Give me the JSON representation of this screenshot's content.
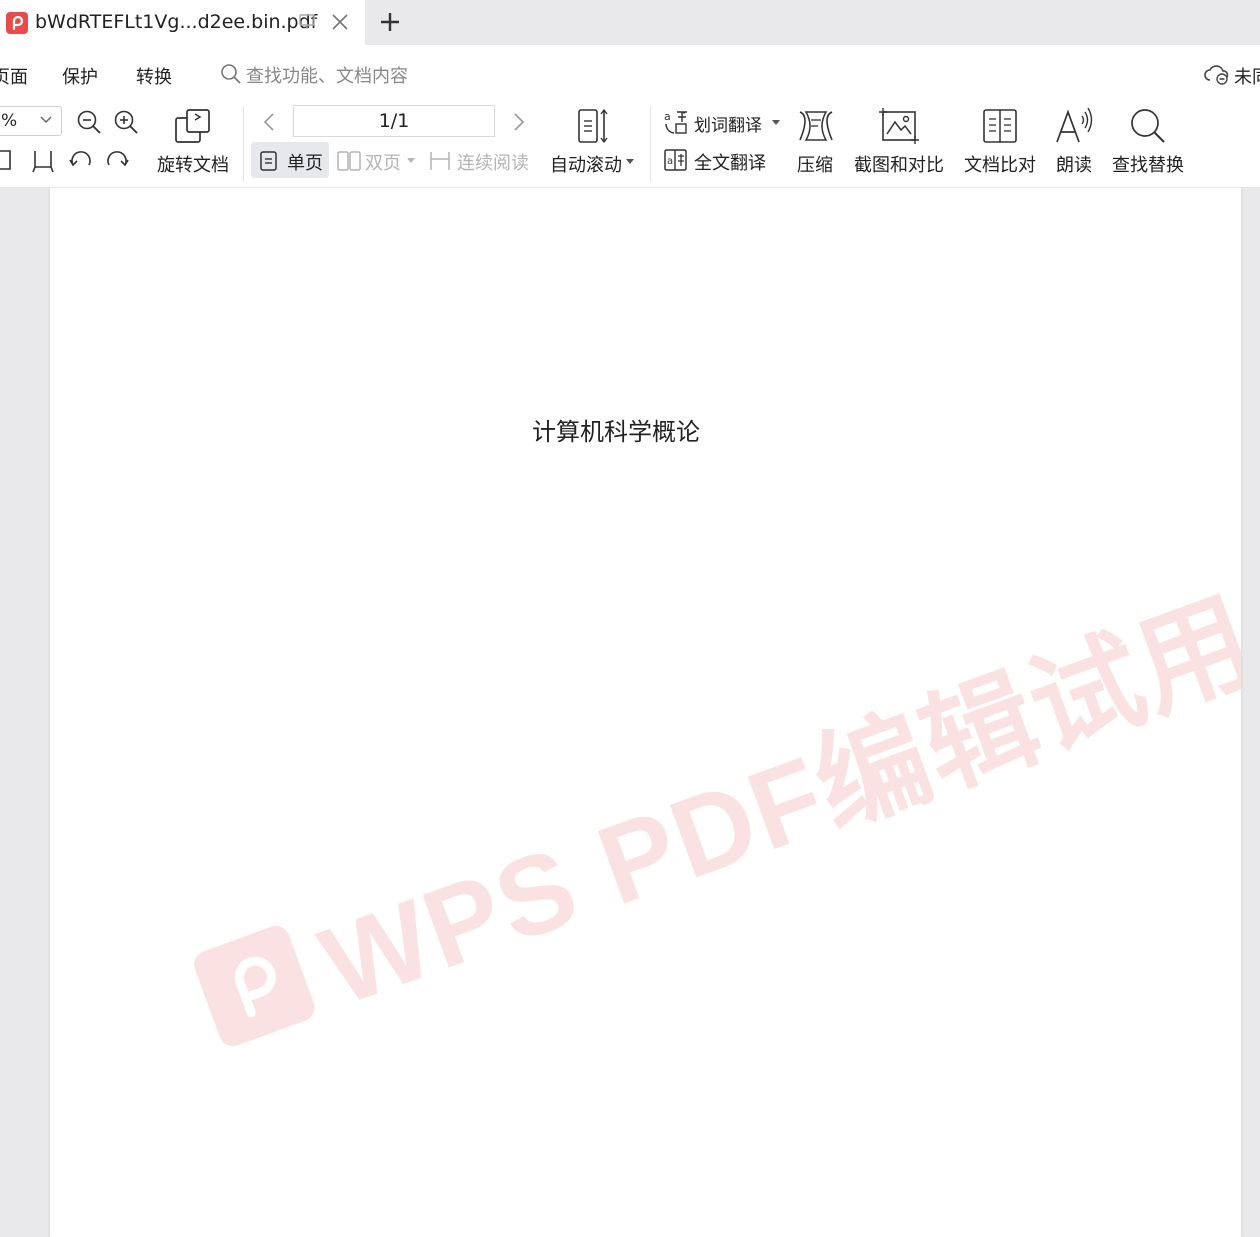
{
  "tab": {
    "title": "bWdRTEFLt1Vg...d2ee.bin.pdf",
    "new_tab": "+"
  },
  "menu": {
    "items": [
      "页面",
      "保护",
      "转换"
    ],
    "search_placeholder": "查找功能、文档内容",
    "cloud_status": "未同"
  },
  "toolbar": {
    "zoom_value": "%",
    "rotate_doc": "旋转文档",
    "page_indicator": "1/1",
    "single_page": "单页",
    "double_page": "双页",
    "continuous": "连续阅读",
    "auto_scroll": "自动滚动",
    "word_translate": "划词翻译",
    "full_translate": "全文翻译",
    "compress": "压缩",
    "screenshot_compare": "截图和对比",
    "doc_compare": "文档比对",
    "read_aloud": "朗读",
    "find_replace": "查找替换"
  },
  "document": {
    "title": "计算机科学概论",
    "watermark": "WPS PDF编辑试用"
  },
  "colors": {
    "accent_red": "#e94a4a",
    "background": "#e9e9ec"
  }
}
